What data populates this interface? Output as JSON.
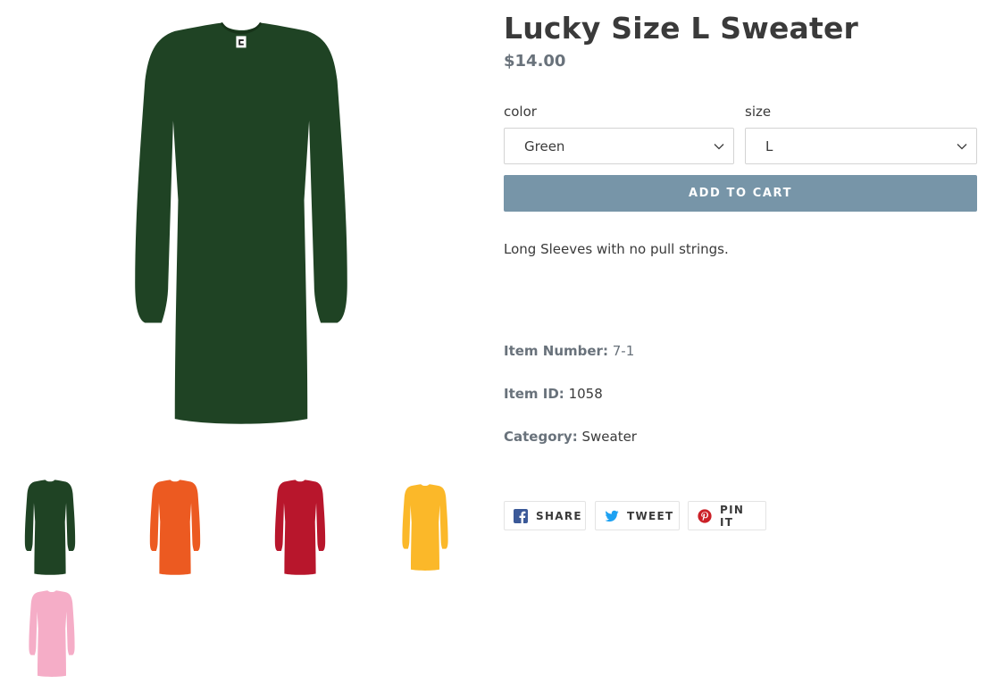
{
  "product": {
    "title": "Lucky Size L Sweater",
    "price": "$14.00",
    "description": "Long Sleeves with no pull strings."
  },
  "options": {
    "color": {
      "label": "color",
      "value": "Green"
    },
    "size": {
      "label": "size",
      "value": "L"
    }
  },
  "add_to_cart_label": "ADD TO CART",
  "details": {
    "item_number": {
      "label": "Item Number:",
      "value": "7-1"
    },
    "item_id": {
      "label": "Item ID:",
      "value": "1058"
    },
    "category": {
      "label": "Category:",
      "value": "Sweater"
    }
  },
  "share": {
    "facebook": "SHARE",
    "twitter": "TWEET",
    "pinterest": "PIN IT"
  },
  "colors": {
    "main_image": "#1f4324",
    "thumbnails": [
      "#1f4324",
      "#ec5a21",
      "#b8162c",
      "#fbb829",
      "#f5adc7"
    ],
    "add_to_cart_bg": "#7795a8",
    "facebook": "#3b5998",
    "twitter": "#1da1f2",
    "pinterest": "#cb2027"
  }
}
